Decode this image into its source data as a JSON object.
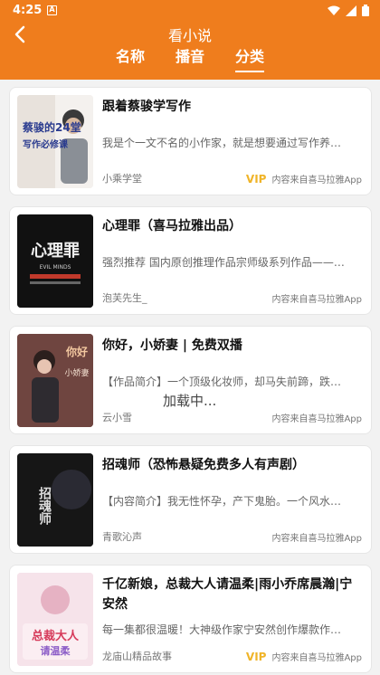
{
  "status": {
    "time": "4:25",
    "a_badge": "A"
  },
  "header": {
    "title": "看小说",
    "tabs": [
      {
        "label": "名称",
        "active": false
      },
      {
        "label": "播音",
        "active": false
      },
      {
        "label": "分类",
        "active": true
      }
    ]
  },
  "books": [
    {
      "title": "跟着蔡骏学写作",
      "desc": "我是个一文不名的小作家，就是想要通过写作养…",
      "author": "小乘学堂",
      "vip": "VIP",
      "source": "内容来自喜马拉雅App",
      "cover_text": [
        "蔡骏的24堂",
        "写作必修课"
      ]
    },
    {
      "title": "心理罪（喜马拉雅出品）",
      "desc": "强烈推荐 国内原创推理作品宗师级系列作品——…",
      "author": "泡芙先生_",
      "vip": "",
      "source": "内容来自喜马拉雅App",
      "cover_text": [
        "心理罪",
        "EVIL MINDS"
      ]
    },
    {
      "title": "你好，小娇妻 | 免费双播",
      "desc": "【作品简介】一个顶级化妆师，却马失前蹄，跌…",
      "author": "云小雪",
      "vip": "",
      "source": "内容来自喜马拉雅App",
      "cover_text": [
        "你好",
        "小娇妻"
      ]
    },
    {
      "title": "招魂师（恐怖悬疑免费多人有声剧）",
      "desc": "【内容简介】我无性怀孕，产下鬼胎。一个风水…",
      "author": "青歌沁声",
      "vip": "",
      "source": "内容来自喜马拉雅App",
      "cover_text": [
        "招魂师"
      ]
    },
    {
      "title": "千亿新娘，总裁大人请温柔|雨小乔席晨瀚|宁安然",
      "desc": "每一集都很温暖！大神级作家宁安然创作爆款作…",
      "author": "龙庙山精品故事",
      "vip": "VIP",
      "source": "内容来自喜马拉雅App",
      "cover_text": [
        "总裁大人",
        "请温柔"
      ]
    }
  ],
  "loading_text": "加载中...",
  "colors": {
    "brand": "#ef7d1d",
    "vip": "#f0b428"
  }
}
